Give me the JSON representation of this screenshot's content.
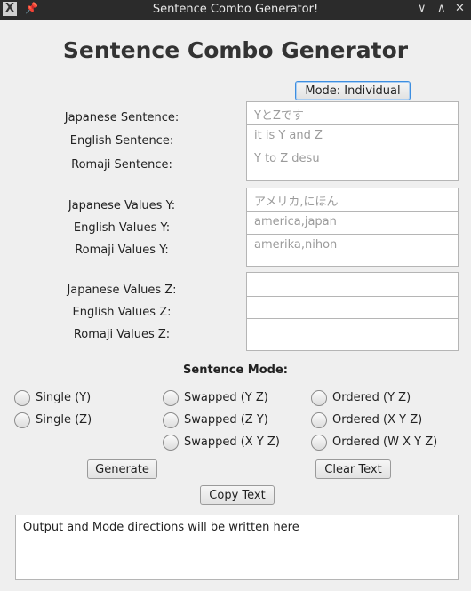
{
  "window": {
    "title": "Sentence Combo Generator!",
    "app_icon": "x-logo-icon",
    "pin_icon": "pin-icon",
    "controls": [
      "chevron-down-icon",
      "chevron-up-icon",
      "close-icon"
    ]
  },
  "heading": "Sentence Combo Generator",
  "mode_button": "Mode: Individual",
  "sentence_fields": [
    {
      "label": "Japanese Sentence:",
      "placeholder": "YとZです"
    },
    {
      "label": "English Sentence:",
      "placeholder": "it is Y and Z"
    },
    {
      "label": "Romaji Sentence:",
      "placeholder": "Y to Z desu"
    }
  ],
  "y_fields": [
    {
      "label": "Japanese Values Y:",
      "placeholder": "アメリカ,にほん"
    },
    {
      "label": "English Values Y:",
      "placeholder": "america,japan"
    },
    {
      "label": "Romaji Values Y:",
      "placeholder": "amerika,nihon"
    }
  ],
  "z_fields": [
    {
      "label": "Japanese Values Z:",
      "placeholder": ""
    },
    {
      "label": "English Values Z:",
      "placeholder": ""
    },
    {
      "label": "Romaji Values Z:",
      "placeholder": ""
    }
  ],
  "sentence_mode_label": "Sentence Mode:",
  "radios": {
    "col1": [
      "Single (Y)",
      "Single (Z)"
    ],
    "col2": [
      "Swapped (Y Z)",
      "Swapped (Z Y)",
      "Swapped (X Y Z)"
    ],
    "col3": [
      "Ordered (Y Z)",
      "Ordered (X Y Z)",
      "Ordered (W X Y Z)"
    ]
  },
  "buttons": {
    "generate": "Generate",
    "clear": "Clear Text",
    "copy": "Copy Text"
  },
  "output_text": "Output and Mode directions will be written here"
}
